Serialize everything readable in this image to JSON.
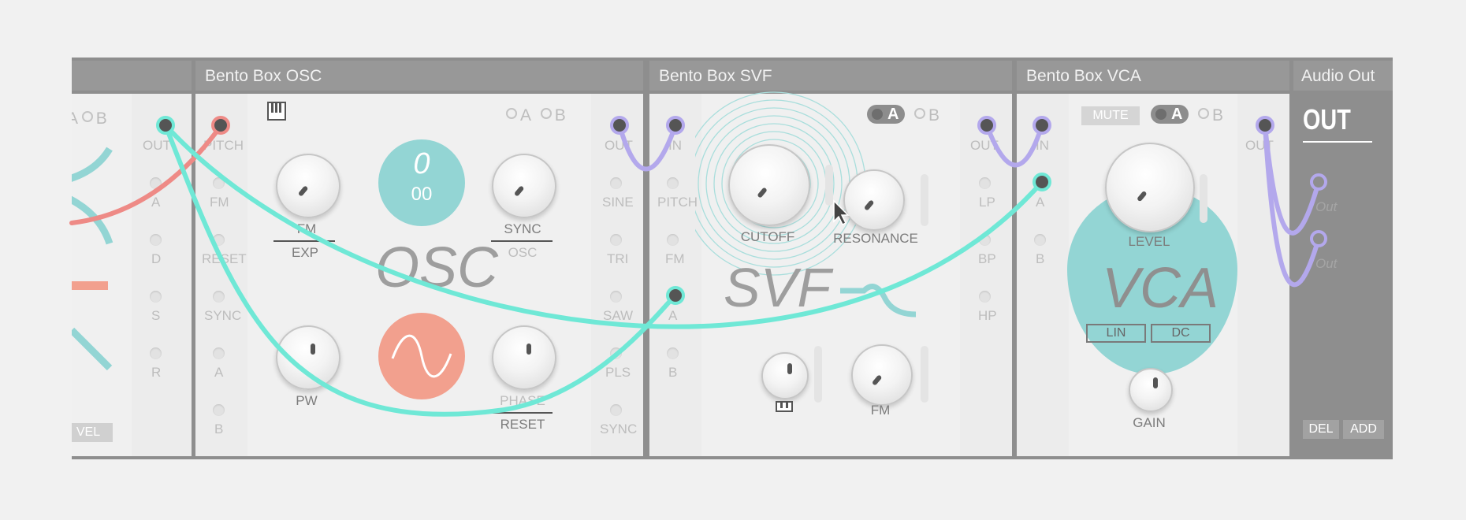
{
  "modules": {
    "env": {
      "ab": {
        "a": "A",
        "b": "B"
      },
      "out": "OUT",
      "inputs": [
        "A",
        "D",
        "S",
        "R"
      ],
      "vel": "VEL"
    },
    "osc": {
      "title": "Bento Box OSC",
      "pitch": "PITCH",
      "left_jacks": [
        "FM",
        "RESET",
        "SYNC",
        "A",
        "B"
      ],
      "ab": {
        "a": "A",
        "b": "B"
      },
      "knobs": {
        "fm": "FM",
        "exp": "EXP",
        "sync": "SYNC",
        "osc": "OSC",
        "pw": "PW",
        "phase": "PHASE",
        "reset": "RESET"
      },
      "display_top": "0",
      "display_bottom": "00",
      "big_label": "OSC",
      "right_jacks": [
        "OUT",
        "SINE",
        "TRI",
        "SAW",
        "PLS",
        "SYNC"
      ]
    },
    "svf": {
      "title": "Bento Box SVF",
      "left_jacks": [
        "IN",
        "PITCH",
        "FM",
        "A",
        "B"
      ],
      "ab": {
        "a": "A",
        "b": "B"
      },
      "knobs": {
        "cutoff": "CUTOFF",
        "resonance": "RESONANCE",
        "fm": "FM"
      },
      "big_label": "SVF",
      "right_jacks": [
        "OUT",
        "LP",
        "BP",
        "HP"
      ]
    },
    "vca": {
      "title": "Bento Box VCA",
      "left_jacks": [
        "IN",
        "A",
        "B"
      ],
      "mute": "MUTE",
      "ab": {
        "a": "A",
        "b": "B"
      },
      "knobs": {
        "level": "LEVEL",
        "gain": "GAIN"
      },
      "big_label": "VCA",
      "lin": "LIN",
      "dc": "DC",
      "right_jacks": [
        "OUT"
      ]
    },
    "audio_out": {
      "title": "Audio Out",
      "big_label": "OUT",
      "jacks": [
        "Out",
        "Out"
      ],
      "del": "DEL",
      "add": "ADD"
    }
  },
  "colors": {
    "teal": "#93d5d4",
    "cable_teal": "#6fe8d6",
    "salmon": "#f2a08e",
    "red_cable": "#ee8a86",
    "purple": "#b3a8ec"
  },
  "icons": {
    "piano": "piano-icon",
    "cursor": "mouse-cursor-icon"
  }
}
